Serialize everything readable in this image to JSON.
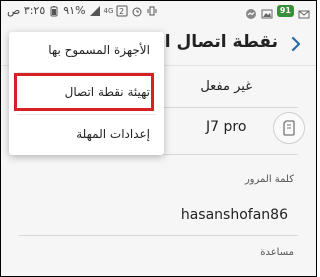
{
  "status_bar": {
    "time": "٣:٢٥ ص",
    "battery": "٩١%",
    "network_type": "4G",
    "notification_badge": "91",
    "icons": [
      "signal-icon",
      "wifi-hotspot-icon",
      "alarm-icon",
      "messenger-icon"
    ]
  },
  "header": {
    "title": "نقطة اتصال الهواتف"
  },
  "main": {
    "hotspot_status": "غير مفعل",
    "network_name": "J7 pro",
    "password_label": "كلمة المرور",
    "password_value": "hasanshofan86",
    "help_label": "مساعدة"
  },
  "menu": {
    "items": [
      {
        "label": "الأجهزة المسموح بها"
      },
      {
        "label": "تهيئة نقطة اتصال"
      },
      {
        "label": "إعدادات المهلة"
      }
    ],
    "highlighted_index": 1,
    "highlight_color": "#d61f26"
  }
}
